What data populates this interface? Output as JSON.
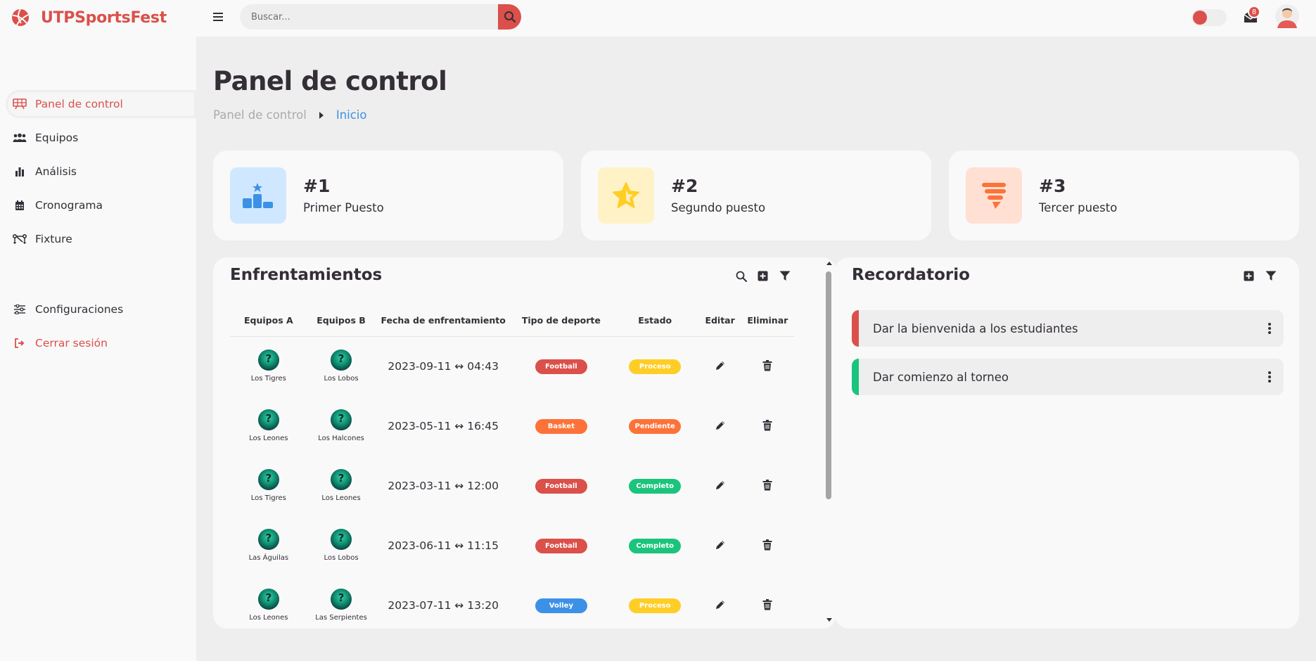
{
  "app": {
    "name": "UTPSportsFest"
  },
  "search": {
    "placeholder": "Buscar..."
  },
  "notifications": {
    "count": "8"
  },
  "sidebar": {
    "items": [
      {
        "label": "Panel de control",
        "icon": "dashboard-icon"
      },
      {
        "label": "Equipos",
        "icon": "people-group-icon"
      },
      {
        "label": "Análisis",
        "icon": "bar-chart-icon"
      },
      {
        "label": "Cronograma",
        "icon": "calendar-icon"
      },
      {
        "label": "Fixture",
        "icon": "bracket-icon"
      }
    ],
    "settings": "Configuraciones",
    "logout": "Cerrar sesión"
  },
  "page": {
    "title": "Panel de control",
    "breadcrumb": [
      "Panel de control",
      "Inicio"
    ]
  },
  "stats": [
    {
      "rank": "#1",
      "label": "Primer Puesto",
      "icon": "podium-icon",
      "bg": "#cfe8ff",
      "fg": "#3c91e6"
    },
    {
      "rank": "#2",
      "label": "Segundo puesto",
      "icon": "star-icon",
      "bg": "#fff2c6",
      "fg": "#ffce26"
    },
    {
      "rank": "#3",
      "label": "Tercer puesto",
      "icon": "tornado-icon",
      "bg": "#ffe0d3",
      "fg": "#fd7238"
    }
  ],
  "matches": {
    "title": "Enfrentamientos",
    "columns": [
      "Equipos A",
      "Equipos B",
      "Fecha de enfrentamiento",
      "Tipo de deporte",
      "Estado",
      "Editar",
      "Eliminar"
    ],
    "rows": [
      {
        "team_a": "Los Tigres",
        "team_b": "Los Lobos",
        "date": "2023-09-11 ↭ 04:43",
        "sport": "Football",
        "status": "Proceso"
      },
      {
        "team_a": "Los Leones",
        "team_b": "Los Halcones",
        "date": "2023-05-11 ↭ 16:45",
        "sport": "Basket",
        "status": "Pendiente"
      },
      {
        "team_a": "Los Tigres",
        "team_b": "Los Leones",
        "date": "2023-03-11 ↭ 12:00",
        "sport": "Football",
        "status": "Completo"
      },
      {
        "team_a": "Las Águilas",
        "team_b": "Los Lobos",
        "date": "2023-06-11 ↭ 11:15",
        "sport": "Football",
        "status": "Completo"
      },
      {
        "team_a": "Los Leones",
        "team_b": "Las Serpientes",
        "date": "2023-07-11 ↭ 13:20",
        "sport": "Volley",
        "status": "Proceso"
      }
    ]
  },
  "colors": {
    "brand": "#db504a",
    "sport": {
      "Football": "#db504a",
      "Basket": "#fd7238",
      "Volley": "#3c91e6"
    },
    "status": {
      "Proceso": "#ffce26",
      "Pendiente": "#fd7238",
      "Completo": "#1bc47d"
    }
  },
  "reminders": {
    "title": "Recordatorio",
    "items": [
      {
        "text": "Dar la bienvenida a los estudiantes",
        "color": "#db504a"
      },
      {
        "text": "Dar comienzo al torneo",
        "color": "#1bc47d"
      }
    ]
  }
}
